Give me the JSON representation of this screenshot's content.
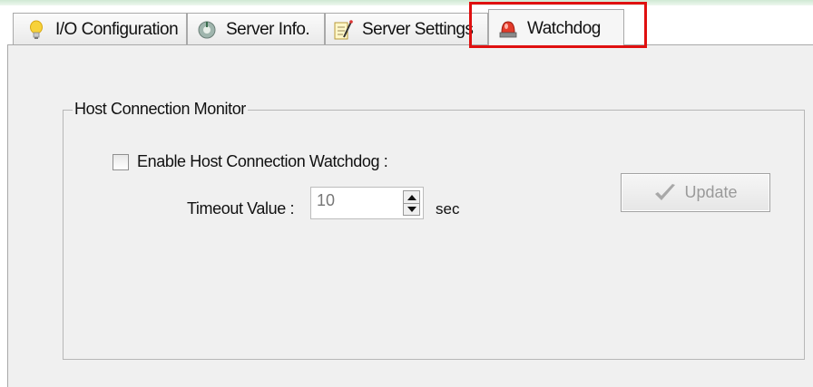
{
  "tabs": [
    {
      "label": "I/O Configuration",
      "icon": "lightbulb-icon",
      "active": false
    },
    {
      "label": "Server Info.",
      "icon": "info-disc-icon",
      "active": false
    },
    {
      "label": "Server Settings",
      "icon": "settings-notepad-icon",
      "active": false
    },
    {
      "label": "Watchdog",
      "icon": "alarm-light-icon",
      "active": true
    }
  ],
  "watchdog": {
    "group_title": "Host Connection Monitor",
    "enable_label": "Enable Host Connection Watchdog :",
    "enable_checked": false,
    "timeout_label": "Timeout Value :",
    "timeout_value": "10",
    "timeout_unit": "sec",
    "update_label": "Update",
    "update_enabled": false
  },
  "colors": {
    "highlight": "#e01010",
    "panel_bg": "#f0f0f0",
    "disabled_text": "#9a9a9a"
  }
}
